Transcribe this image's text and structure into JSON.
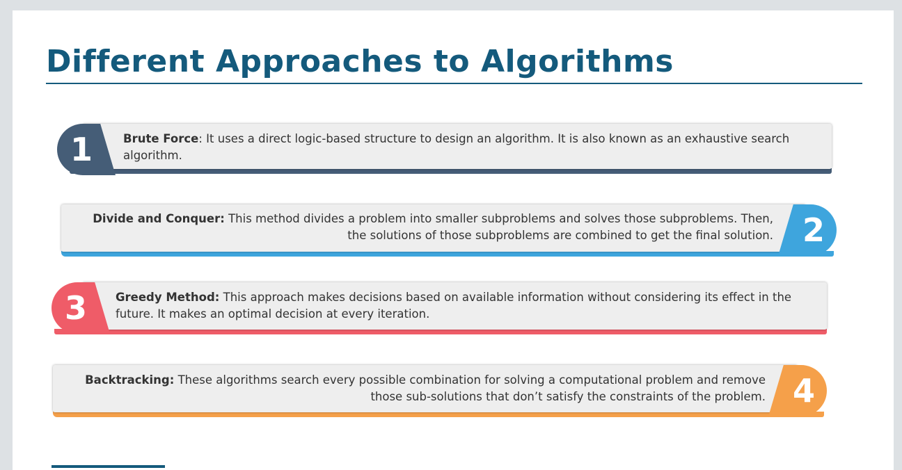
{
  "title": "Different Approaches to Algorithms",
  "colors": {
    "title": "#145a7c",
    "item1": "#455d77",
    "item2": "#3ea5dd",
    "item3": "#ef5c68",
    "item4": "#f5a04a",
    "card": "#eeeeee"
  },
  "items": [
    {
      "number": "1",
      "term": "Brute Force",
      "sep": ": ",
      "description": "It uses a direct logic-based structure to design an algorithm. It is also known as an exhaustive search algorithm."
    },
    {
      "number": "2",
      "term": "Divide and Conquer:",
      "sep": " ",
      "description": "This method divides a problem into smaller subproblems and solves those subproblems. Then, the solutions of those subproblems are combined to get the final solution."
    },
    {
      "number": "3",
      "term": "Greedy Method:",
      "sep": " ",
      "description": "This approach makes decisions based on available information without considering its effect in the future. It makes an optimal decision at every iteration."
    },
    {
      "number": "4",
      "term": "Backtracking:",
      "sep": " ",
      "description": "These algorithms search every possible combination for solving a computational problem and remove those sub-solutions that don’t satisfy the constraints of the problem."
    }
  ]
}
